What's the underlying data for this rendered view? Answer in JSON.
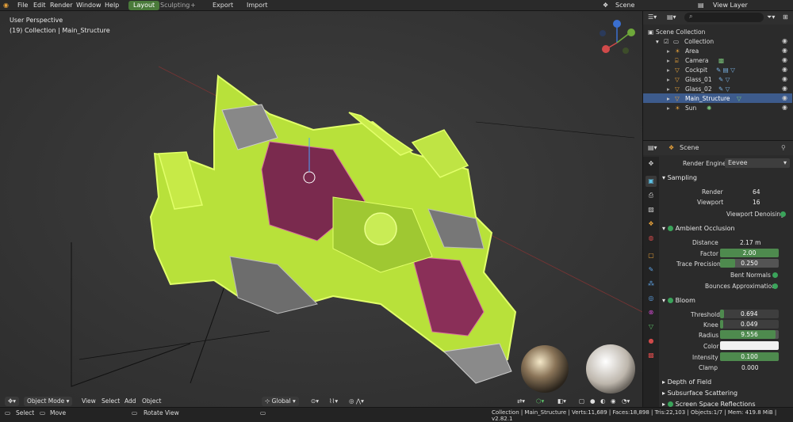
{
  "topbar": {
    "menus": [
      "File",
      "Edit",
      "Render",
      "Window",
      "Help"
    ],
    "tabs": [
      "Layout",
      "Sculpting",
      "Export",
      "Import"
    ],
    "scene": "Scene",
    "view_layer": "View Layer"
  },
  "viewport": {
    "info_line1": "User Perspective",
    "info_line2": "(19) Collection | Main_Structure",
    "mode": "Object Mode",
    "header_menus": [
      "View",
      "Select",
      "Add",
      "Object"
    ],
    "orientation": "Global"
  },
  "outliner": {
    "root": "Scene Collection",
    "collection": "Collection",
    "items": [
      "Area",
      "Camera",
      "Cockpit",
      "Glass_01",
      "Glass_02",
      "Main_Structure",
      "Sun"
    ],
    "selected": "Main_Structure"
  },
  "properties": {
    "context": "Scene",
    "render_engine_label": "Render Engine",
    "render_engine": "Eevee",
    "sampling": {
      "title": "Sampling",
      "render_label": "Render",
      "render": "64",
      "viewport_label": "Viewport",
      "viewport": "16",
      "denoise_label": "Viewport Denoising"
    },
    "ao": {
      "title": "Ambient Occlusion",
      "distance_label": "Distance",
      "distance": "2.17 m",
      "factor_label": "Factor",
      "factor": "2.00",
      "factor_fill": 1.0,
      "precision_label": "Trace Precision",
      "precision": "0.250",
      "precision_fill": 0.25,
      "bent_label": "Bent Normals",
      "bounces_label": "Bounces Approximation"
    },
    "bloom": {
      "title": "Bloom",
      "threshold_label": "Threshold",
      "threshold": "0.694",
      "threshold_fill": 0.07,
      "knee_label": "Knee",
      "knee": "0.049",
      "knee_fill": 0.05,
      "radius_label": "Radius",
      "radius": "9.556",
      "radius_fill": 0.95,
      "color_label": "Color",
      "intensity_label": "Intensity",
      "intensity": "0.100",
      "intensity_fill": 1.0,
      "clamp_label": "Clamp",
      "clamp": "0.000"
    },
    "collapsed": [
      "Depth of Field",
      "Subsurface Scattering",
      "Screen Space Reflections"
    ]
  },
  "statusbar": {
    "select": "Select",
    "move": "Move",
    "rotate": "Rotate View",
    "info": "Collection | Main_Structure | Verts:11,689 | Faces:18,898 | Tris:22,103 | Objects:1/7 | Mem: 419.8 MiB | v2.82.1"
  },
  "colors": {
    "accent_green": "#4e8a4e",
    "selection_blue": "#3d5b8c",
    "ship_green": "#b8e13a",
    "active_tab": "#4a7a3a"
  }
}
